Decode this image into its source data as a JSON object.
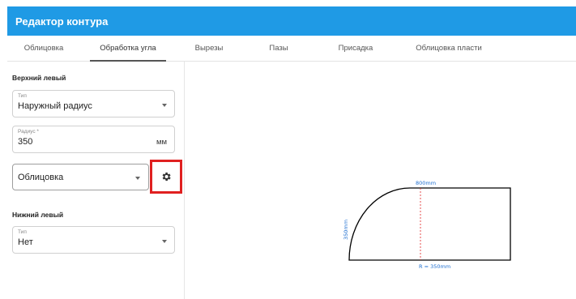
{
  "app": {
    "title": "Редактор контура"
  },
  "tabs": [
    {
      "label": "Облицовка"
    },
    {
      "label": "Обработка угла"
    },
    {
      "label": "Вырезы"
    },
    {
      "label": "Пазы"
    },
    {
      "label": "Присадка"
    },
    {
      "label": "Облицовка пласти"
    }
  ],
  "active_tab": "Обработка угла",
  "top_left": {
    "section_title": "Верхний левый",
    "type_field": {
      "label": "Тип",
      "value": "Наружный радиус"
    },
    "radius_field": {
      "label": "Радиус *",
      "value": "350",
      "unit": "мм"
    },
    "edging_select": {
      "value": "Облицовка"
    },
    "settings_icon": "gear-icon"
  },
  "bottom_left": {
    "section_title": "Нижний левый",
    "type_field": {
      "label": "Тип",
      "value": "Нет"
    }
  },
  "drawing": {
    "width_label": "800mm",
    "height_label": "350mm",
    "radius_label": "R = 350mm"
  },
  "colors": {
    "appbar": "#1f9ae5",
    "highlight": "#e02020",
    "centerline": "#e02020",
    "dimension_text": "#1f6fd0"
  }
}
